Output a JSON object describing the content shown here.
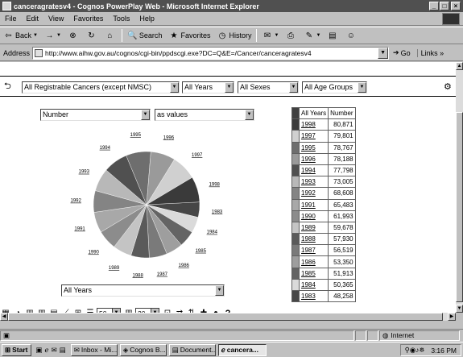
{
  "window": {
    "title": "canceragratesv4 - Cognos PowerPlay Web - Microsoft Internet Explorer",
    "controls": [
      "_",
      "□",
      "×"
    ]
  },
  "menu": [
    "File",
    "Edit",
    "View",
    "Favorites",
    "Tools",
    "Help"
  ],
  "toolbar": {
    "back": "Back",
    "forward_glyph": "→",
    "search": "Search",
    "favorites": "Favorites",
    "history": "History"
  },
  "address": {
    "label": "Address",
    "url": "http://www.aihw.gov.au/cognos/cgi-bin/ppdscgi.exe?DC=Q&E=/Cancer/canceragratesv4",
    "go": "Go",
    "links": "Links"
  },
  "filters": {
    "cancers": "All Registrable Cancers (except NMSC)",
    "years": "All Years",
    "sexes": "All Sexes",
    "ages": "All Age Groups"
  },
  "measure": {
    "measure": "Number",
    "display": "as values"
  },
  "bottom_select": "All Years",
  "table": {
    "headers": [
      "All Years",
      "Number"
    ],
    "rows": [
      {
        "year": "1998",
        "value": "80,871",
        "color": "#3a3a3a"
      },
      {
        "year": "1997",
        "value": "79,801",
        "color": "#d0d0d0"
      },
      {
        "year": "1995",
        "value": "78,767",
        "color": "#6e6e6e"
      },
      {
        "year": "1996",
        "value": "78,188",
        "color": "#9a9a9a"
      },
      {
        "year": "1994",
        "value": "77,798",
        "color": "#505050"
      },
      {
        "year": "1993",
        "value": "73,005",
        "color": "#b8b8b8"
      },
      {
        "year": "1992",
        "value": "68,608",
        "color": "#848484"
      },
      {
        "year": "1991",
        "value": "65,483",
        "color": "#a8a8a8"
      },
      {
        "year": "1990",
        "value": "61,993",
        "color": "#8c8c8c"
      },
      {
        "year": "1989",
        "value": "59,678",
        "color": "#c4c4c4"
      },
      {
        "year": "1988",
        "value": "57,930",
        "color": "#5a5a5a"
      },
      {
        "year": "1987",
        "value": "56,519",
        "color": "#7a7a7a"
      },
      {
        "year": "1986",
        "value": "53,350",
        "color": "#9e9e9e"
      },
      {
        "year": "1985",
        "value": "51,913",
        "color": "#646464"
      },
      {
        "year": "1984",
        "value": "50,365",
        "color": "#dadada"
      },
      {
        "year": "1983",
        "value": "48,258",
        "color": "#464646"
      }
    ]
  },
  "bottom_toolbar": {
    "rows_value": "50",
    "cols_value": "20",
    "help": "?"
  },
  "status": {
    "zone": "Internet"
  },
  "taskbar": {
    "start": "Start",
    "tasks": [
      "Inbox - Mi...",
      "Cognos B...",
      "Document...",
      "cancera..."
    ],
    "clock": "3:16 PM"
  }
}
